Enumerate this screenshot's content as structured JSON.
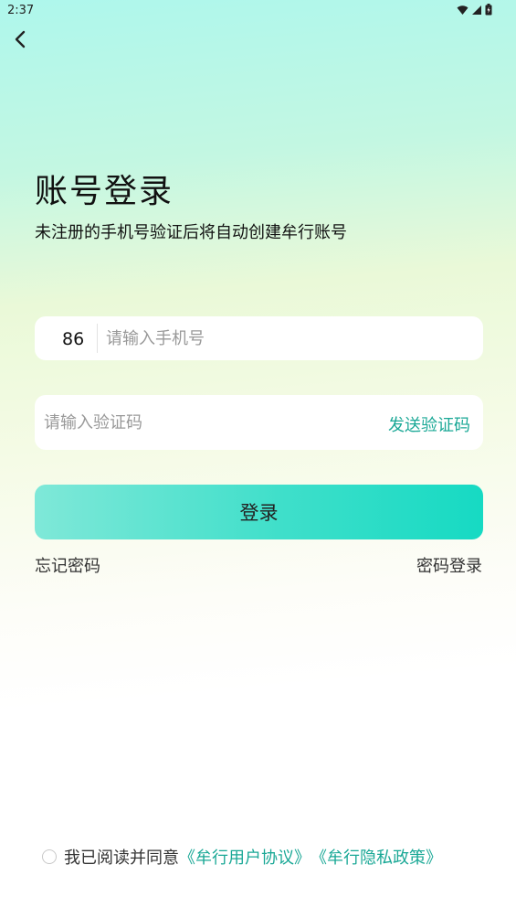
{
  "status_bar": {
    "time": "2:37",
    "icons": [
      "wifi-icon",
      "signal-icon",
      "battery-icon"
    ]
  },
  "header": {
    "back_icon": "chevron-left-icon"
  },
  "page": {
    "title": "账号登录",
    "subtitle": "未注册的手机号验证后将自动创建牟行账号"
  },
  "phone_field": {
    "country_code": "86",
    "placeholder": "请输入手机号",
    "value": ""
  },
  "code_field": {
    "placeholder": "请输入验证码",
    "value": "",
    "send_label": "发送验证码"
  },
  "login_button": {
    "label": "登录"
  },
  "links": {
    "forgot_password": "忘记密码",
    "password_login": "密码登录"
  },
  "agreement": {
    "checked": false,
    "prefix": "我已阅读并同意",
    "user_agreement": "《牟行用户协议》",
    "privacy_policy": "《牟行隐私政策》"
  },
  "colors": {
    "accent": "#1aa896",
    "button_start": "#7fe8d8",
    "button_end": "#16dac3"
  }
}
